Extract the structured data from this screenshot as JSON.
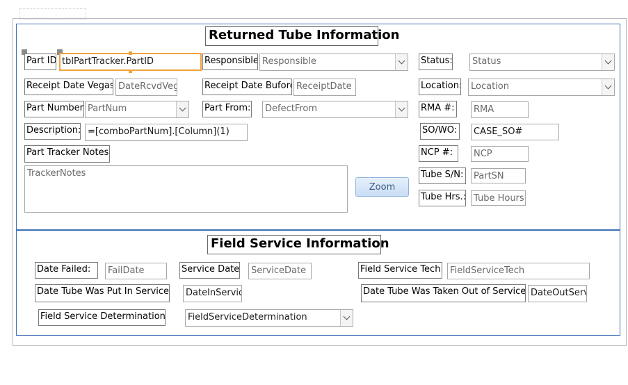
{
  "returned": {
    "title": "Returned Tube Information",
    "part_id_label": "Part ID",
    "part_id_value": "tblPartTracker.PartID",
    "responsible_label": "Responsible:",
    "responsible_value": "Responsible",
    "status_label": "Status:",
    "status_value": "Status",
    "receipt_vegas_label": "Receipt Date Vegas:",
    "receipt_vegas_value": "DateRcvdVega",
    "receipt_buford_label": "Receipt Date Buford:",
    "receipt_buford_value": "ReceiptDate",
    "location_label": "Location:",
    "location_value": "Location",
    "part_number_label": "Part Number:",
    "part_number_value": "PartNum",
    "part_from_label": "Part From:",
    "part_from_value": "DefectFrom",
    "rma_label": "RMA #:",
    "rma_value": "RMA",
    "description_label": "Description:",
    "description_value": "=[comboPartNum].[Column](1)",
    "so_wo_label": "SO/WO:",
    "so_wo_value": "CASE_SO#",
    "tracker_notes_label": "Part Tracker Notes:",
    "tracker_notes_value": "TrackerNotes",
    "ncp_label": "NCP #:",
    "ncp_value": "NCP",
    "zoom_label": "Zoom",
    "tube_sn_label": "Tube S/N:",
    "tube_sn_value": "PartSN",
    "tube_hrs_label": "Tube Hrs.:",
    "tube_hrs_value": "Tube Hours"
  },
  "field_service": {
    "title": "Field Service Information",
    "date_failed_label": "Date Failed:",
    "date_failed_value": "FailDate",
    "service_date_label": "Service Date:",
    "service_date_value": "ServiceDate",
    "tech_label": "Field Service Tech:",
    "tech_value": "FieldServiceTech",
    "put_in_label": "Date Tube Was Put In Service:",
    "put_in_value": "DateInService",
    "taken_out_label": "Date Tube Was Taken Out of Service:",
    "taken_out_value": "DateOutServi",
    "determination_label": "Field Service Determination:",
    "determination_value": "FieldServiceDetermination"
  },
  "colors": {
    "section_border": "#3d6fb6",
    "selection": "#f2a13c",
    "button": "#c9ddf4"
  }
}
